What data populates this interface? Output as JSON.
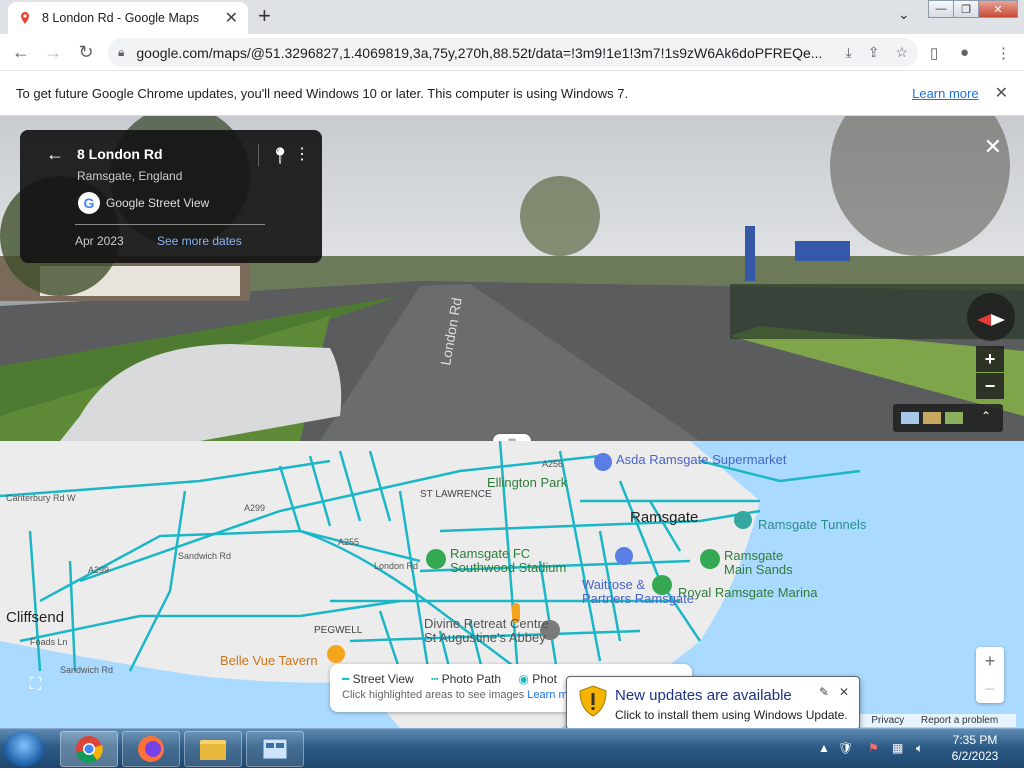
{
  "browser": {
    "tab_title": "8 London Rd - Google Maps",
    "url": "google.com/maps/@51.3296827,1.4069819,3a,75y,270h,88.52t/data=!3m9!1e1!3m7!1s9zW6Ak6doPFREQe...",
    "new_tab": "+",
    "tab_close": "✕",
    "tab_menu": "⌄",
    "win_min": "—",
    "win_max": "❐",
    "win_close": "✕"
  },
  "infobar": {
    "message": "To get future Google Chrome updates, you'll need Windows 10 or later. This computer is using Windows 7.",
    "link": "Learn more",
    "close": "✕"
  },
  "streetview_card": {
    "title": "8 London Rd",
    "subtitle": "Ramsgate, England",
    "source": "Google Street View",
    "date": "Apr 2023",
    "see_more": "See more dates"
  },
  "streetview_scene": {
    "road_marking": "London Rd"
  },
  "map": {
    "places": [
      {
        "name": "Asda Ramsgate\nSupermarket"
      },
      {
        "name": "Ellington Park"
      },
      {
        "name": "ST LAWRENCE"
      },
      {
        "name": "Ramsgate"
      },
      {
        "name": "Ramsgate Tunnels"
      },
      {
        "name": "Ramsgate FC\nSouthwood Stadium"
      },
      {
        "name": "Ramsgate\nMain Sands"
      },
      {
        "name": "Waitrose &\nPartners Ramsgate"
      },
      {
        "name": "Royal Ramsgate Marina"
      },
      {
        "name": "Cliffsend"
      },
      {
        "name": "PEGWELL"
      },
      {
        "name": "Divine Retreat Centre\nSt Augustine's Abbey"
      },
      {
        "name": "Belle Vue Tavern"
      }
    ],
    "roads": [
      "Canterbury Rd W",
      "A299",
      "A255",
      "Sandwich Rd",
      "London Rd",
      "A256",
      "A299",
      "Foads Ln",
      "Sandwich Rd"
    ],
    "zoom_in": "+",
    "zoom_out": "−"
  },
  "legend": {
    "street_view": "Street View",
    "photo_path": "Photo Path",
    "photos": "Phot",
    "hint": "Click highlighted areas to see images",
    "learn_more": "Learn m"
  },
  "footer": {
    "terms": "ns",
    "privacy": "Privacy",
    "report": "Report a problem"
  },
  "notification": {
    "title": "New updates are available",
    "body": "Click to install them using Windows Update."
  },
  "taskbar": {
    "time": "7:35 PM",
    "date": "6/2/2023"
  },
  "colors": {
    "accent": "#1a73e8",
    "map_roads": "#1bb7c6",
    "marker_green": "#34a853"
  }
}
